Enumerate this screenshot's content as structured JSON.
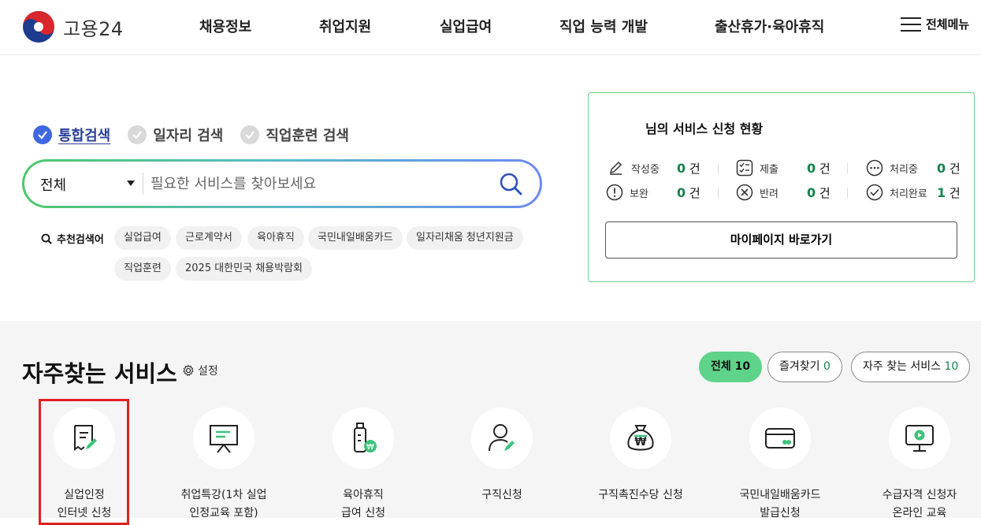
{
  "header": {
    "logo_text": "고용24",
    "nav": [
      "채용정보",
      "취업지원",
      "실업급여",
      "직업 능력 개발",
      "출산휴가·육아휴직"
    ],
    "menu_label": "전체메뉴"
  },
  "search": {
    "tabs": [
      {
        "label": "통합검색",
        "active": true
      },
      {
        "label": "일자리 검색",
        "active": false
      },
      {
        "label": "직업훈련 검색",
        "active": false
      }
    ],
    "scope": "전체",
    "placeholder": "필요한 서비스를 찾아보세요",
    "recommended_label": "추천검색어",
    "keywords": [
      "실업급여",
      "근로계약서",
      "육아휴직",
      "국민내일배움카드",
      "일자리채움 청년지원금",
      "직업훈련",
      "2025 대한민국 채용박람회"
    ]
  },
  "status": {
    "title": "님의 서비스 신청 현황",
    "items": [
      {
        "label": "작성중",
        "count": "0",
        "icon": "pencil-icon"
      },
      {
        "label": "제출",
        "count": "0",
        "icon": "checklist-icon"
      },
      {
        "label": "처리중",
        "count": "0",
        "icon": "dots-icon"
      },
      {
        "label": "보완",
        "count": "0",
        "icon": "exclamation-icon"
      },
      {
        "label": "반려",
        "count": "0",
        "icon": "x-circle-icon"
      },
      {
        "label": "처리완료",
        "count": "1",
        "icon": "check-circle-icon"
      }
    ],
    "unit": "건",
    "mypage_button": "마이페이지 바로가기"
  },
  "frequent": {
    "title": "자주찾는 서비스",
    "settings_label": "설정",
    "filters": [
      {
        "label": "전체",
        "count": "10",
        "active": true
      },
      {
        "label": "즐겨찾기",
        "count": "0",
        "active": false
      },
      {
        "label": "자주 찾는 서비스",
        "count": "10",
        "active": false
      }
    ],
    "services": [
      {
        "line1": "실업인정",
        "line2": "인터넷 신청",
        "icon": "document-pen-icon"
      },
      {
        "line1": "취업특강(1차 실업",
        "line2": "인정교육 포함)",
        "icon": "presentation-board-icon"
      },
      {
        "line1": "육아휴직",
        "line2": "급여 신청",
        "icon": "baby-bottle-won-icon"
      },
      {
        "line1": "구직신청",
        "line2": "",
        "icon": "person-pen-icon"
      },
      {
        "line1": "구직촉진수당 신청",
        "line2": "",
        "icon": "money-bag-won-icon"
      },
      {
        "line1": "국민내일배움카드",
        "line2": "발급신청",
        "icon": "card-icon"
      },
      {
        "line1": "수급자격 신청자",
        "line2": "온라인 교육",
        "icon": "monitor-play-icon"
      }
    ]
  },
  "colors": {
    "accent_green": "#15834a",
    "chip_green": "#5fd38a",
    "tab_blue": "#3f67e0",
    "highlight_red": "#e02020"
  }
}
